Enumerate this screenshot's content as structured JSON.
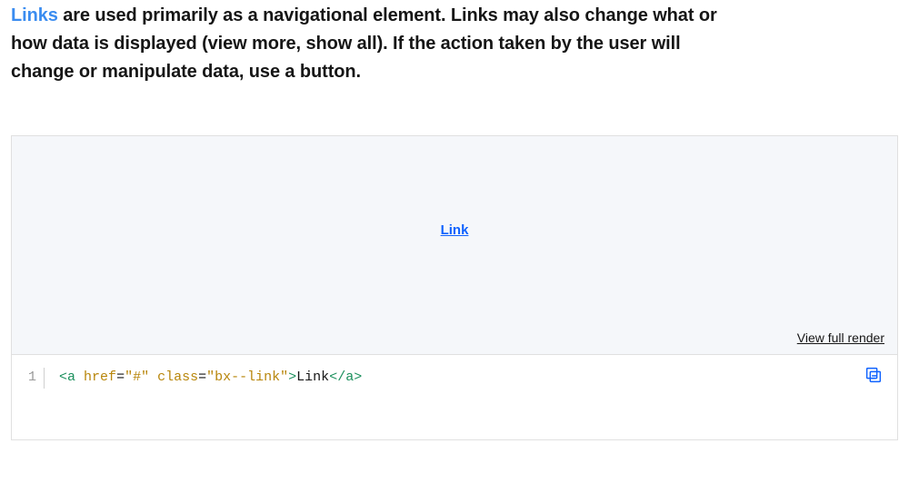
{
  "intro": {
    "link_word": "Links",
    "rest": " are used primarily as a navigational element. Links may also change what or how data is displayed (view more, show all). If the action taken by the user will change or manipulate data, use a button."
  },
  "example": {
    "preview_link_label": "Link",
    "view_full_label": "View full render",
    "code": {
      "line_number": "1",
      "open_angle": "<",
      "tag_a": "a",
      "space": " ",
      "attr_href": "href",
      "eq": "=",
      "val_href": "\"#\"",
      "attr_class": "class",
      "val_class": "\"bx--link\"",
      "close_angle": ">",
      "inner_text": "Link",
      "open_angle_close": "</",
      "close_close": ">"
    },
    "copy_label": "Copy code"
  }
}
